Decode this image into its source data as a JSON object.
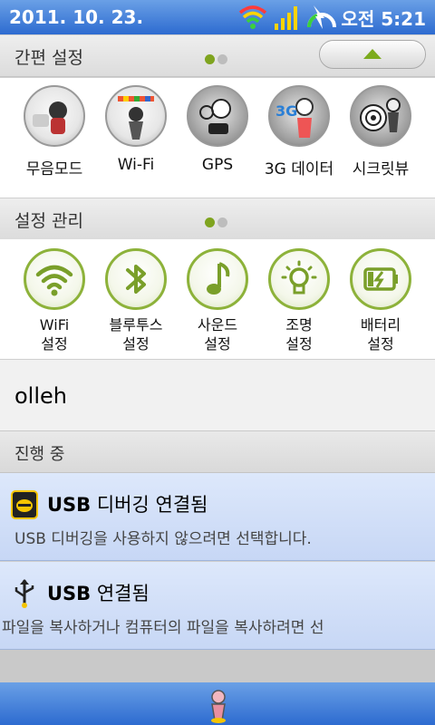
{
  "status_bar": {
    "date": "2011. 10. 23.",
    "ampm": "오전",
    "time": "5:21"
  },
  "quick_settings": {
    "title": "간편 설정",
    "modes": [
      {
        "label": "무음모드",
        "icon": "silent-mode-icon"
      },
      {
        "label": "Wi-Fi",
        "icon": "wifi-mode-icon"
      },
      {
        "label": "GPS",
        "icon": "gps-mode-icon"
      },
      {
        "label": "3G 데이터",
        "icon": "3g-data-icon",
        "badge": "3G"
      },
      {
        "label": "시크릿뷰",
        "icon": "secret-view-icon"
      }
    ]
  },
  "settings_manage": {
    "title": "설정 관리",
    "items": [
      {
        "line1": "WiFi",
        "line2": "설정",
        "icon": "wifi-icon"
      },
      {
        "line1": "블루투스",
        "line2": "설정",
        "icon": "bluetooth-icon"
      },
      {
        "line1": "사운드",
        "line2": "설정",
        "icon": "music-note-icon"
      },
      {
        "line1": "조명",
        "line2": "설정",
        "icon": "light-bulb-icon"
      },
      {
        "line1": "배터리",
        "line2": "설정",
        "icon": "battery-icon"
      }
    ]
  },
  "operator": "olleh",
  "ongoing_title": "진행 중",
  "notifications": [
    {
      "bold": "USB",
      "title": " 디버깅 연결됨",
      "text": "USB 디버깅을 사용하지 않으려면 선택합니다.",
      "icon": "usb-debug-icon"
    },
    {
      "bold": "USB",
      "title": " 연결됨",
      "text": "파일을 복사하거나 컴퓨터의 파일을 복사하려면 선",
      "icon": "usb-icon"
    }
  ],
  "colors": {
    "accent_green": "#8db23a",
    "status_blue": "#2d6bd0"
  }
}
